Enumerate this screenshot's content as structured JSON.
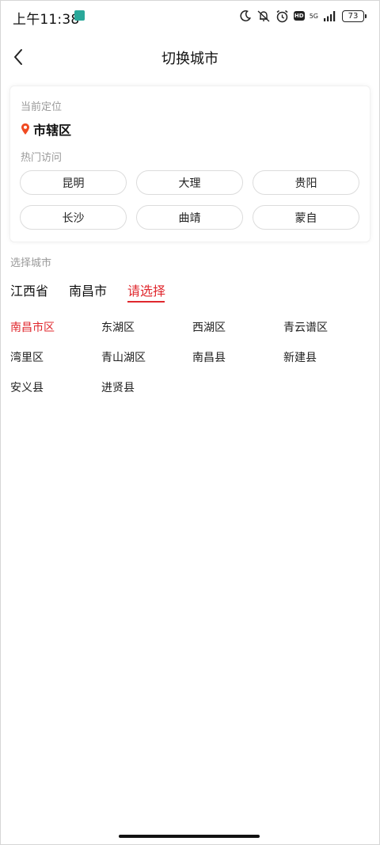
{
  "status_bar": {
    "time": "上午11:38",
    "network": "5G",
    "battery": "73"
  },
  "header": {
    "title": "切换城市"
  },
  "location": {
    "current_label": "当前定位",
    "current_value": "市辖区",
    "hot_label": "热门访问",
    "hot_cities": [
      "昆明",
      "大理",
      "贵阳",
      "长沙",
      "曲靖",
      "蒙自"
    ]
  },
  "select": {
    "label": "选择城市",
    "tabs": [
      "江西省",
      "南昌市",
      "请选择"
    ],
    "districts": [
      "南昌市区",
      "东湖区",
      "西湖区",
      "青云谱区",
      "湾里区",
      "青山湖区",
      "南昌县",
      "新建县",
      "安义县",
      "进贤县"
    ]
  },
  "colors": {
    "accent": "#e0282e",
    "pin": "#f04b22"
  },
  "icons": {
    "back": "chevron-left-icon",
    "location": "map-pin-icon"
  }
}
